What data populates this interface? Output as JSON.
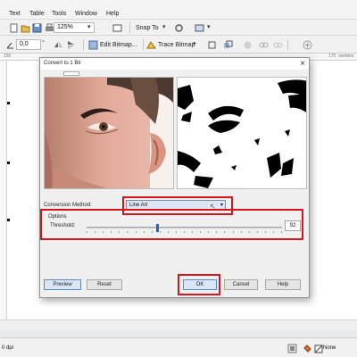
{
  "menubar": {
    "items": [
      {
        "label": "Text",
        "underline": "x"
      },
      {
        "label": "Table",
        "underline": "T"
      },
      {
        "label": "Tools",
        "underline": "o"
      },
      {
        "label": "Window",
        "underline": "W"
      },
      {
        "label": "Help",
        "underline": "H"
      }
    ]
  },
  "toolbar1": {
    "zoom_value": "125%",
    "snap_label": "Snap To"
  },
  "toolbar2": {
    "angle_value": "0,0",
    "edit_bitmap_label": "Edit Bitmap...",
    "trace_bitmap_label": "Trace Bitmap"
  },
  "ruler": {
    "left_label": "150",
    "right_label": "170",
    "units_label": "centime"
  },
  "status": {
    "dpi_text": "0 dpi",
    "fill_text": "None"
  },
  "dialog": {
    "title": "Convert to 1 Bit",
    "conversion_label": "Conversion Method:",
    "conversion_value": "Line Art",
    "options_label": "Options",
    "threshold_label": "Threshold:",
    "threshold_value": "92",
    "threshold_fraction": 0.36,
    "buttons": {
      "preview": "Preview",
      "reset": "Reset",
      "ok": "OK",
      "cancel": "Cancel",
      "help": "Help"
    }
  },
  "colors": {
    "highlight": "#d8141c",
    "selected_field": "#dde6f2",
    "slider_thumb": "#1e62c4"
  },
  "icons": [
    "new-icon",
    "open-icon",
    "save-icon",
    "print-icon",
    "undo-icon",
    "redo-icon",
    "zoom-dropdown-icon",
    "fullscreen-icon",
    "snap-dropdown-icon",
    "options-icon",
    "angle-icon",
    "edit-bitmap-icon",
    "trace-bitmap-icon",
    "close-icon"
  ]
}
